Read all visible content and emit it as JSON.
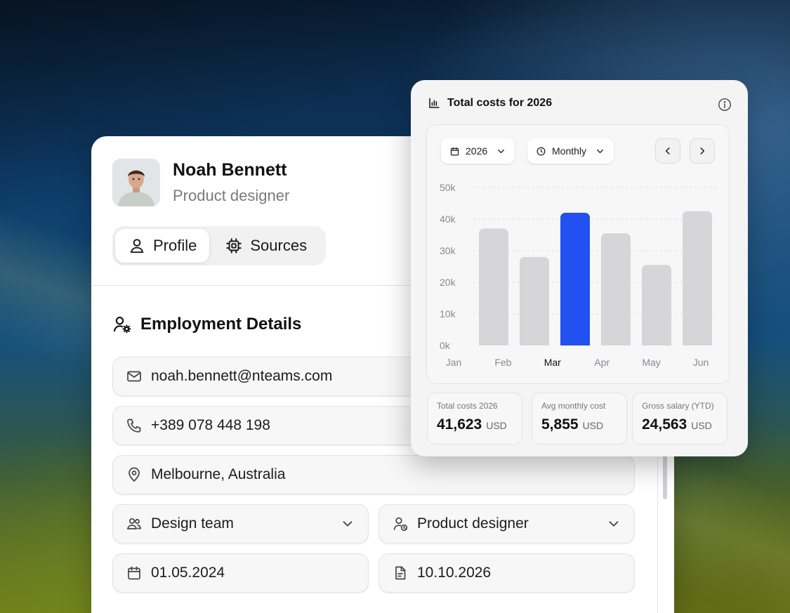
{
  "profile": {
    "name": "Noah Bennett",
    "role": "Product designer",
    "tabs": [
      {
        "label": "Profile",
        "icon": "user-icon",
        "active": true
      },
      {
        "label": "Sources",
        "icon": "chip-icon",
        "active": false
      }
    ]
  },
  "employment": {
    "title": "Employment Details",
    "email": "noah.bennett@nteams.com",
    "phone": "+389 078 448 198",
    "location": "Melbourne, Australia",
    "team": "Design team",
    "position": "Product designer",
    "start_date": "01.05.2024",
    "end_date": "10.10.2026"
  },
  "costs_card": {
    "title": "Total costs for 2026",
    "year_select": "2026",
    "period_select": "Monthly",
    "stats": [
      {
        "label": "Total costs 2026",
        "value": "41,623",
        "unit": "USD"
      },
      {
        "label": "Avg monthly cost",
        "value": "5,855",
        "unit": "USD"
      },
      {
        "label": "Gross salary (YTD)",
        "value": "24,563",
        "unit": "USD"
      }
    ]
  },
  "colors": {
    "accent": "#2350f0",
    "bar": "#d6d6d9"
  },
  "chart_data": {
    "type": "bar",
    "categories": [
      "Jan",
      "Feb",
      "Mar",
      "Apr",
      "May",
      "Jun"
    ],
    "values": [
      37000,
      28000,
      42000,
      35500,
      25500,
      42500
    ],
    "highlight": "Mar",
    "y_ticks": [
      "0k",
      "10k",
      "20k",
      "30k",
      "40k",
      "50k"
    ],
    "ylim": [
      0,
      50000
    ],
    "grid": true
  }
}
